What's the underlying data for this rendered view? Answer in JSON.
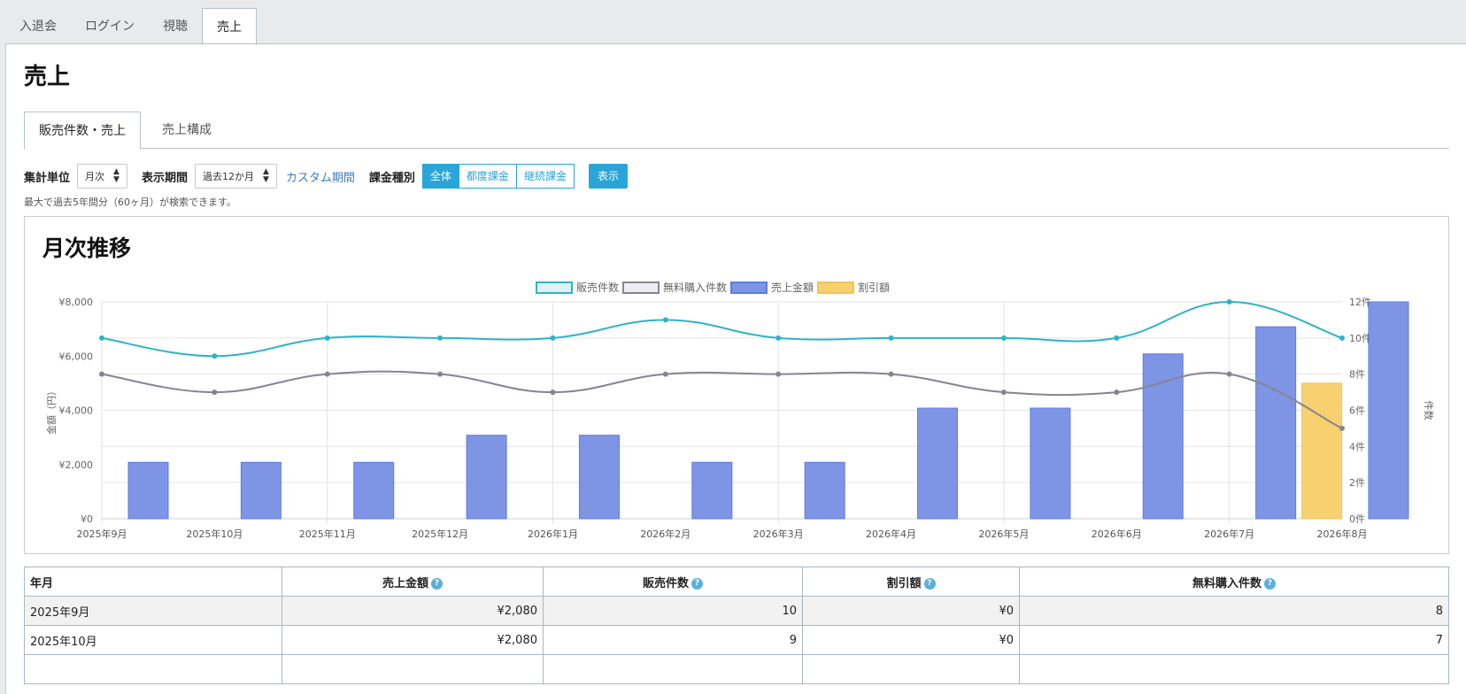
{
  "top_tabs": [
    {
      "label": "入退会"
    },
    {
      "label": "ログイン"
    },
    {
      "label": "視聴"
    },
    {
      "label": "売上"
    }
  ],
  "page_title": "売上",
  "sub_tabs": [
    {
      "label": "販売件数・売上"
    },
    {
      "label": "売上構成"
    }
  ],
  "filters": {
    "unit_label": "集計単位",
    "unit_value": "月次",
    "period_label": "表示期間",
    "period_value": "過去12か月",
    "custom_period_link": "カスタム期間",
    "billing_label": "課金種別",
    "billing_options": [
      "全体",
      "都度課金",
      "継続課金"
    ],
    "show_button": "表示"
  },
  "note": "最大で過去5年間分（60ヶ月）が検索できます。",
  "chart_title": "月次推移",
  "colors": {
    "sales_count": "#2fb3c8",
    "free_count": "#858592",
    "revenue": "#7e95e6",
    "discount": "#f7d070",
    "accent": "#2aa5d8"
  },
  "chart_data": {
    "type": "bar",
    "categories": [
      "2025年9月",
      "2025年10月",
      "2025年11月",
      "2025年12月",
      "2026年1月",
      "2026年2月",
      "2026年3月",
      "2026年4月",
      "2026年5月",
      "2026年6月",
      "2026年7月",
      "2026年8月"
    ],
    "y_left": {
      "label": "金額（円）",
      "min": 0,
      "max": 8000,
      "ticks": [
        "¥0",
        "¥2,000",
        "¥4,000",
        "¥6,000",
        "¥8,000"
      ]
    },
    "y_right": {
      "label": "件数",
      "min": 0,
      "max": 12,
      "ticks": [
        "0件",
        "2件",
        "4件",
        "6件",
        "8件",
        "10件",
        "12件"
      ]
    },
    "series": [
      {
        "name": "販売件数",
        "type": "line",
        "axis": "right",
        "values": [
          10,
          9,
          10,
          10,
          10,
          11,
          10,
          10,
          10,
          10,
          12,
          10
        ]
      },
      {
        "name": "無料購入件数",
        "type": "line",
        "axis": "right",
        "values": [
          8,
          7,
          8,
          8,
          7,
          8,
          8,
          8,
          7,
          7,
          8,
          5
        ]
      },
      {
        "name": "売上金額",
        "type": "bar",
        "axis": "left",
        "values": [
          2080,
          2080,
          2080,
          3080,
          3080,
          2080,
          2080,
          4080,
          4080,
          6080,
          7080,
          8000
        ]
      },
      {
        "name": "割引額",
        "type": "bar",
        "axis": "left",
        "values": [
          0,
          0,
          0,
          0,
          0,
          0,
          0,
          0,
          0,
          0,
          5000,
          0
        ]
      }
    ],
    "legend_position": "top-center",
    "grid": true
  },
  "table": {
    "headers": [
      "年月",
      "売上金額",
      "販売件数",
      "割引額",
      "無料購入件数"
    ],
    "rows": [
      [
        "2025年9月",
        "¥2,080",
        "10",
        "¥0",
        "8"
      ],
      [
        "2025年10月",
        "¥2,080",
        "9",
        "¥0",
        "7"
      ]
    ]
  }
}
